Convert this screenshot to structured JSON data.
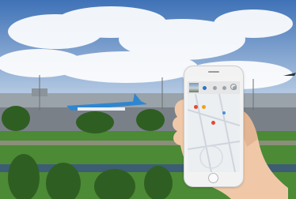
{
  "scene": {
    "sky_top": "#3f72b7",
    "sky_bottom": "#bcd0e6",
    "grass": "#4c8a35",
    "tree": "#2f5e22",
    "aircraft_livery": "#2f86cf"
  },
  "app": {
    "screen_title": "",
    "tabs": [
      "",
      "",
      "",
      ""
    ],
    "active_tab_index": 0,
    "map_markers": [
      {
        "name": "gate-marker",
        "color": "#e24a33"
      },
      {
        "name": "shop-marker",
        "color": "#f0a020"
      },
      {
        "name": "you-are-here-marker",
        "color": "#2a74c8"
      }
    ],
    "icons": [
      "compass-icon",
      "photo-thumbnail",
      "home-button"
    ]
  }
}
